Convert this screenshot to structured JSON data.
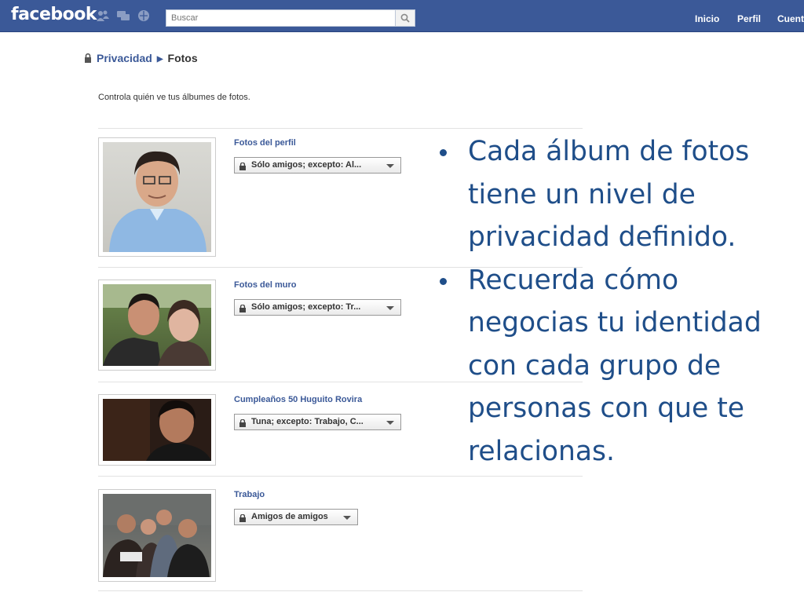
{
  "header": {
    "logo": "facebook",
    "search_placeholder": "Buscar",
    "nav": [
      "Inicio",
      "Perfil",
      "Cuent"
    ]
  },
  "breadcrumb": {
    "parent": "Privacidad",
    "current": "Fotos"
  },
  "description": "Controla quién ve tus álbumes de fotos.",
  "albums": [
    {
      "title": "Fotos del perfil",
      "privacy": "Sólo amigos; excepto: Al..."
    },
    {
      "title": "Fotos del muro",
      "privacy": "Sólo amigos; excepto: Tr..."
    },
    {
      "title": "Cumpleaños 50 Huguito Rovira",
      "privacy": "Tuna; excepto: Trabajo, C..."
    },
    {
      "title": "Trabajo",
      "privacy": "Amigos de amigos"
    }
  ],
  "slide_bullets": [
    "Cada álbum de fotos tiene un nivel de privacidad definido.",
    "Recuerda cómo negocias tu identidad con cada grupo de personas con que te relacionas."
  ],
  "colors": {
    "brand_blue": "#3b5998",
    "slide_text": "#1f4e89"
  }
}
